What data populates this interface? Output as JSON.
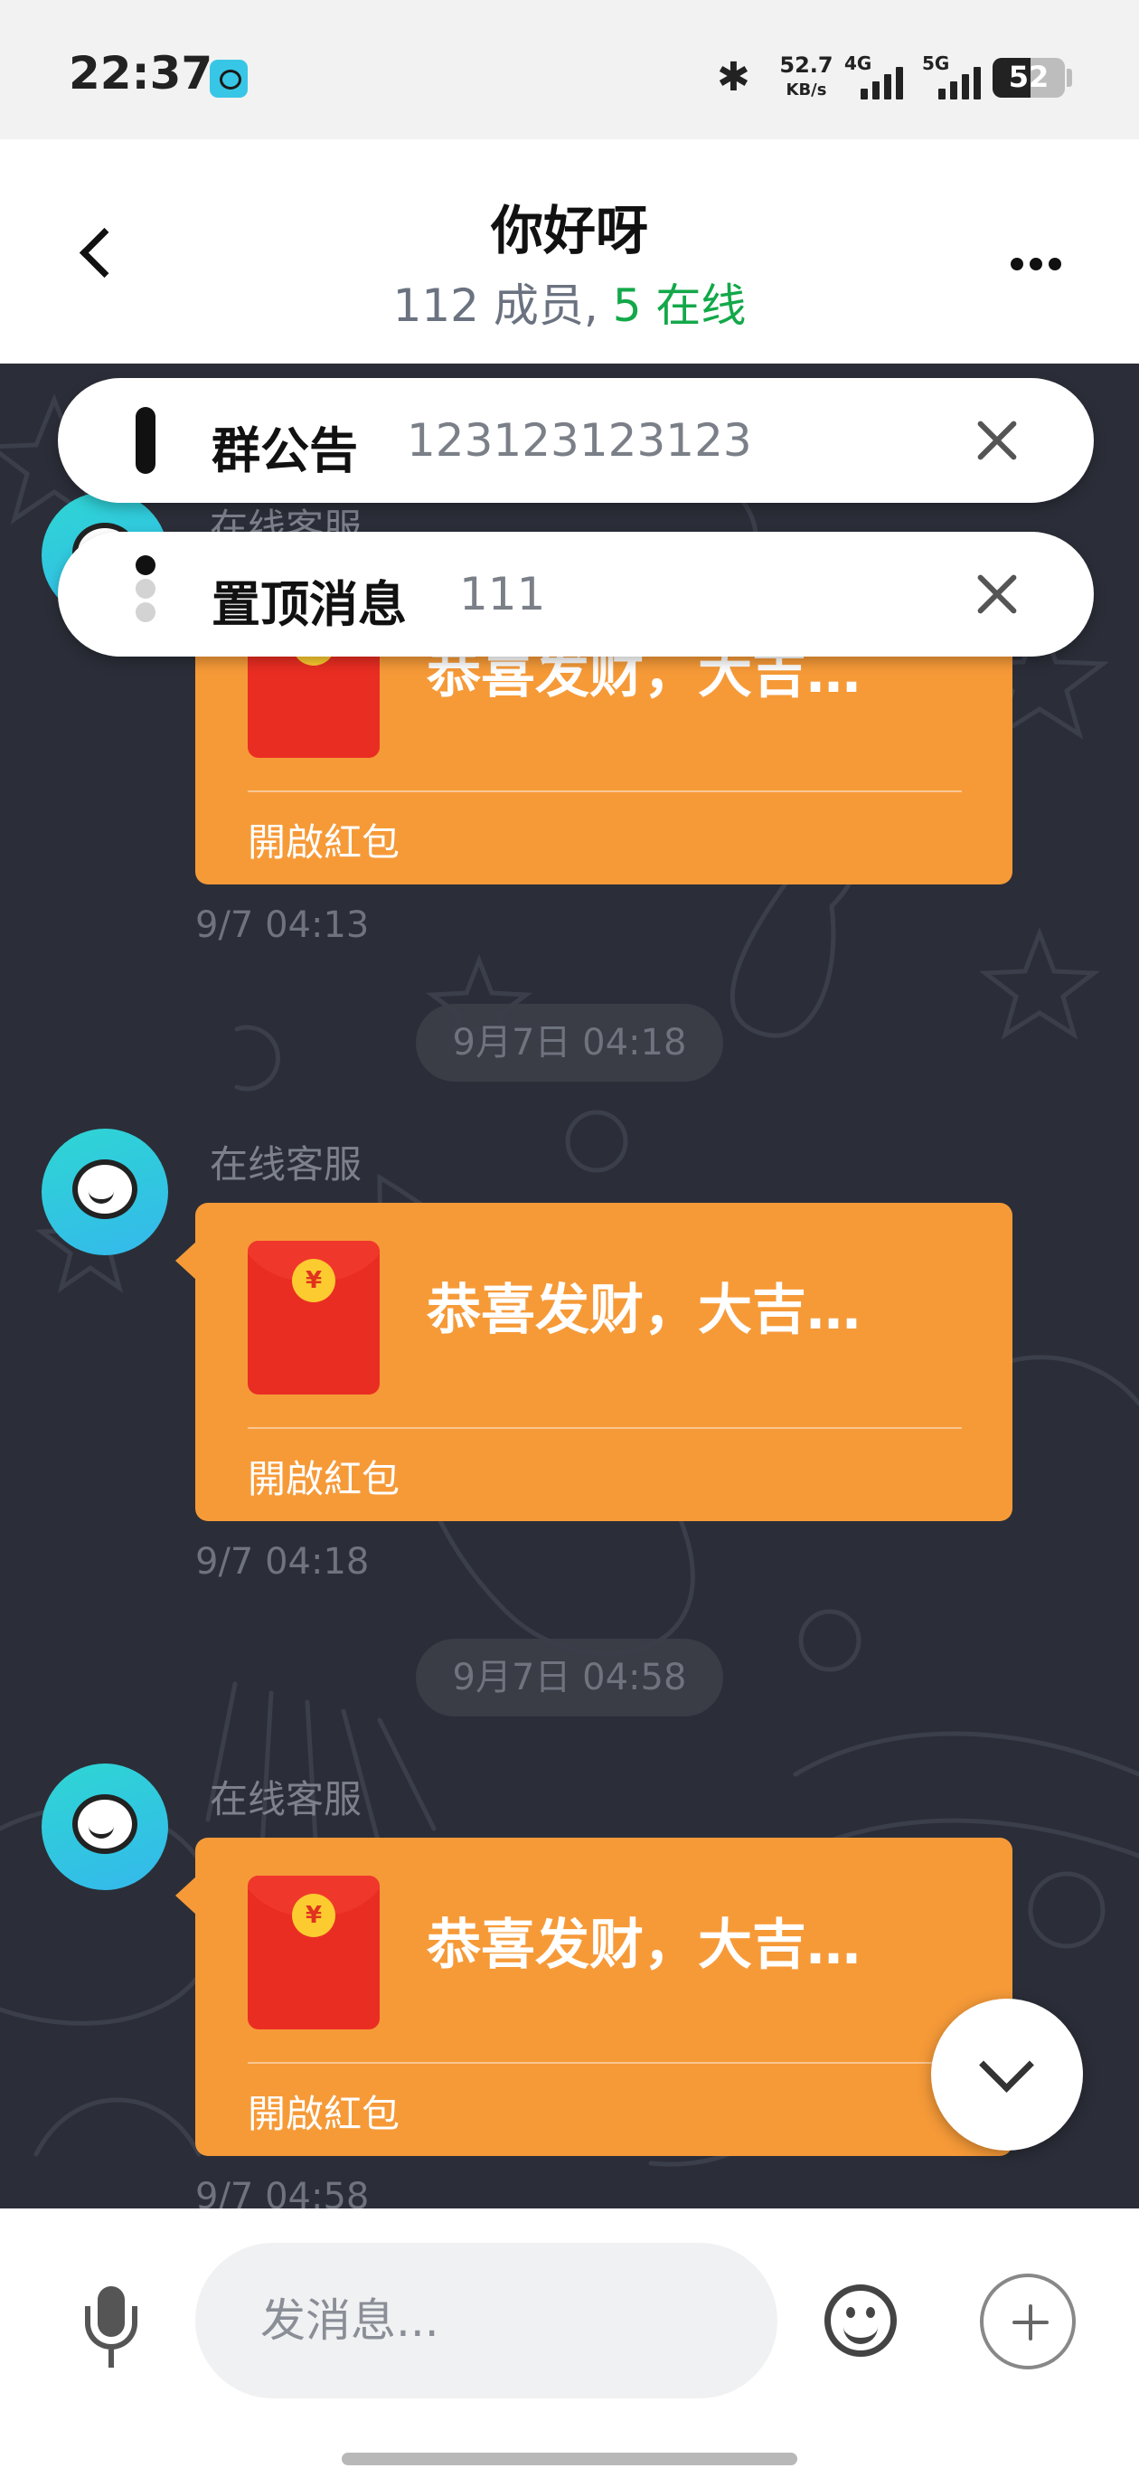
{
  "status_bar": {
    "time": "22:37",
    "notification_icon": "chat-app-icon",
    "bluetooth_icon": "bluetooth-icon",
    "speed_value": "52.7",
    "speed_unit": "KB/s",
    "signal_1_type": "4G",
    "signal_2_type": "5G",
    "battery_level": "52"
  },
  "header": {
    "back_icon": "back-arrow-icon",
    "title": "你好呀",
    "members_text": "112 成员,",
    "online_text": "5 在线",
    "more_icon": "more-dots-icon"
  },
  "pinned": {
    "announcement_label": "群公告",
    "announcement_text": "123123123123",
    "pinned_label": "置顶消息",
    "pinned_text": "111",
    "close_icon": "close-icon"
  },
  "messages": [
    {
      "sender": "在线客服",
      "red_packet_title": "恭喜发财，大吉…",
      "action": "開啟紅包",
      "time": "9/7 04:13"
    },
    {
      "sender": "在线客服",
      "red_packet_title": "恭喜发财，大吉…",
      "action": "開啟紅包",
      "time": "9/7 04:18"
    },
    {
      "sender": "在线客服",
      "red_packet_title": "恭喜发财，大吉…",
      "action": "開啟紅包",
      "time": "9/7 04:58"
    }
  ],
  "date_separators": [
    "9月7日 04:18",
    "9月7日 04:58"
  ],
  "coin_symbol": "¥",
  "input_bar": {
    "placeholder": "发消息...",
    "mic_icon": "microphone-icon",
    "emoji_icon": "emoji-icon",
    "plus_icon": "plus-icon"
  },
  "colors": {
    "online_green": "#13a84a",
    "bubble_orange": "#f69a38",
    "chat_background": "#2b2e38",
    "avatar_cyan": "#34b8ec"
  }
}
